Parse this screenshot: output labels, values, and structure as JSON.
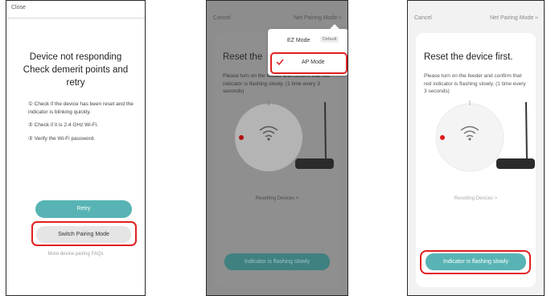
{
  "panel1": {
    "close_label": "Close",
    "title_lines": [
      "Device not responding",
      "Check demerit points and",
      "retry"
    ],
    "tips": [
      {
        "marker": "①",
        "text": "Check if the device has been reset and the indicator is blinking quickly."
      },
      {
        "marker": "②",
        "text": "Check if it is 2.4 GHz Wi-Fi."
      },
      {
        "marker": "③",
        "text": "Verify the Wi-Fi password."
      }
    ],
    "retry_label": "Retry",
    "switch_label": "Switch Pairing Mode",
    "faq_label": "More device pairing FAQs"
  },
  "panel2": {
    "cancel_label": "Cancel",
    "mode_label": "Net Pairing Mode ≈",
    "title": "Reset the",
    "desc": "Please turn on the feeder and confirm that red indicator is flashing slowly. (1 time every 3 seconds)",
    "reset_link": "Resetting Devices >",
    "button_label": "Indicator is flashing slowly",
    "dropdown": {
      "option1": "EZ Mode",
      "option1_badge": "Default",
      "option2": "AP Mode",
      "selected": "AP Mode"
    }
  },
  "panel3": {
    "cancel_label": "Cancel",
    "mode_label": "Net Pairing Mode ≈",
    "title": "Reset the device first.",
    "desc": "Please turn on the feeder and confirm that red indicator is flashing slowly. (1 time every 3 seconds)",
    "reset_link": "Resetting Devices >",
    "button_label": "Indicator is flashing slowly"
  },
  "colors": {
    "accent": "#58b4b4",
    "highlight": "#e02020",
    "indicator": "#e01b1b"
  },
  "icons": [
    "wifi-icon",
    "check-icon",
    "close-icon"
  ]
}
